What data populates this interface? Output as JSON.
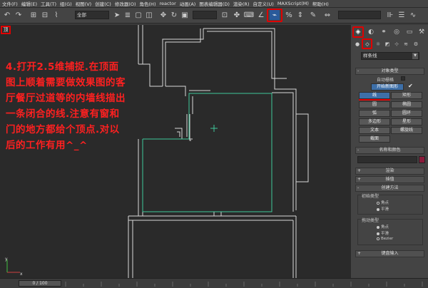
{
  "menubar": {
    "items": [
      "文件(F)",
      "编辑(E)",
      "工具(T)",
      "组(G)",
      "视图(V)",
      "创建(C)",
      "修改器(O)",
      "角色(H)",
      "reactor",
      "动画(A)",
      "图表编辑器(D)",
      "渲染(R)",
      "自定义(U)",
      "MAXScript(M)",
      "帮助(H)"
    ]
  },
  "toolbar": {
    "selection_filter": "全部",
    "snap_toggle_label": "2.5",
    "named_selection": ""
  },
  "viewport": {
    "label": "顶",
    "instruction": "4.打开2.5维捕捉.在顶面图上顺着需要做效果图的客厅餐厅过道等的内墙线描出一条闭合的线.注意有窗和门的地方都给个顶点.对以后的工作有用^_^"
  },
  "command_panel": {
    "category_dropdown": "样条线",
    "object_type_header": "对象类型",
    "auto_grid_label": "自动栅格",
    "start_new_shape_label": "开始新图形",
    "shape_buttons": [
      "线",
      "矩形",
      "圆",
      "椭圆",
      "弧",
      "圆环",
      "多边形",
      "星形",
      "文本",
      "螺旋线",
      "截面"
    ],
    "name_color_header": "名称和颜色",
    "object_name": "",
    "object_color": "#8a1a3a",
    "rollouts": {
      "rendering": "渲染",
      "interpolation": "插值",
      "creation_method": "创建方法",
      "keyboard_entry": "键盘输入"
    },
    "initial_type_label": "初始类型",
    "initial_type_options": [
      "角点",
      "平滑"
    ],
    "initial_type_selected": "角点",
    "drag_type_label": "拖动类型",
    "drag_type_options": [
      "角点",
      "平滑",
      "Bezier"
    ],
    "drag_type_selected": "Bezier"
  },
  "timebar": {
    "frame_readout": "0 / 100"
  },
  "colors": {
    "highlight_red": "#e00000",
    "active_button": "#3d6fa8",
    "wall_line": "#d8d8d8",
    "traced_line": "#3fc89a"
  }
}
